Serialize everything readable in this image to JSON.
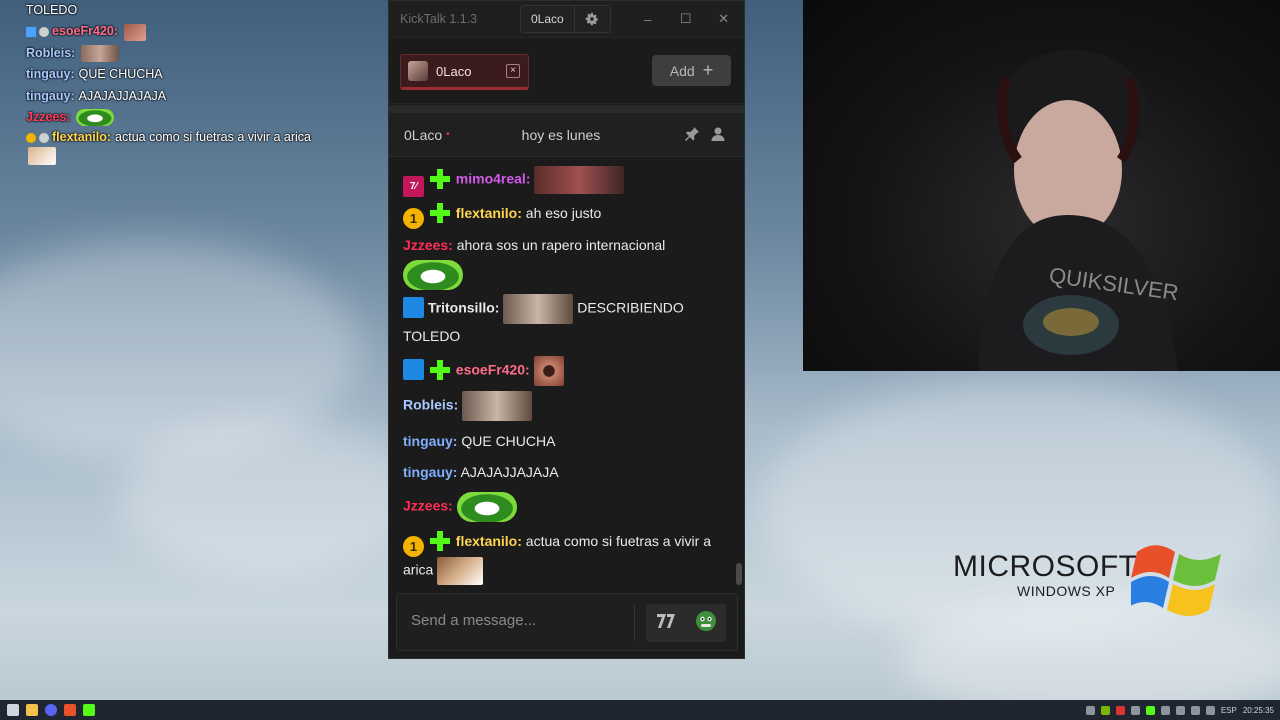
{
  "overlay_chat": [
    {
      "name": "",
      "text": "TOLEDO"
    },
    {
      "name": "esoeFr420:",
      "text": "",
      "name_color": "#ff6b8b"
    },
    {
      "name": "Robleis:",
      "text": "",
      "name_color": "#a9c8ff"
    },
    {
      "name": "tingauy:",
      "text": "QUE CHUCHA",
      "name_color": "#a9c8ff"
    },
    {
      "name": "tingauy:",
      "text": "AJAJAJJAJAJA",
      "name_color": "#a9c8ff"
    },
    {
      "name": "Jzzees:",
      "text": "",
      "name_color": "#ff3b5c"
    },
    {
      "name": "flextanilo:",
      "text": "actua como si fuetras a vivir a arica",
      "name_color": "#ffd54f"
    }
  ],
  "window": {
    "title": "KickTalk 1.1.3",
    "user": "0Laco",
    "minimize": "–",
    "maximize": "☐",
    "close": "✕"
  },
  "tab": {
    "name": "0Laco",
    "close": "×"
  },
  "add_button": {
    "label": "Add",
    "icon": "+"
  },
  "stream": {
    "name": "0Laco",
    "live_dot": "•",
    "title": "hoy es lunes"
  },
  "messages": [
    {
      "name": "mimo4real:",
      "text": "",
      "color": "#d05be8"
    },
    {
      "name": "flextanilo:",
      "text": "ah eso justo",
      "color": "#ffd54f"
    },
    {
      "name": "Jzzees:",
      "text": "ahora sos un rapero internacional",
      "color": "#ff2d55"
    },
    {
      "name": "Tritonsillo:",
      "text": "DESCRIBIENDO TOLEDO",
      "color": "#e8e8e8"
    },
    {
      "name": "esoeFr420:",
      "text": "",
      "color": "#ff6b8b"
    },
    {
      "name": "Robleis:",
      "text": "",
      "color": "#a9c8ff"
    },
    {
      "name": "tingauy:",
      "text": "QUE CHUCHA",
      "color": "#7fb0ff"
    },
    {
      "name": "tingauy:",
      "text": "AJAJAJJAJAJA",
      "color": "#7fb0ff"
    },
    {
      "name": "Jzzees:",
      "text": "",
      "color": "#ff2d55"
    },
    {
      "name": "flextanilo:",
      "text": "actua como si fuetras a vivir a arica",
      "color": "#ffd54f"
    }
  ],
  "input": {
    "placeholder": "Send a message..."
  },
  "desktop_logo": {
    "brand": "MICROSOFT",
    "sub": "WINDOWS XP"
  },
  "taskbar": {
    "lang": "ESP",
    "time": "20:25:35"
  },
  "colors": {
    "kick_green": "#53fc18",
    "accent_red": "#9c2b30"
  }
}
